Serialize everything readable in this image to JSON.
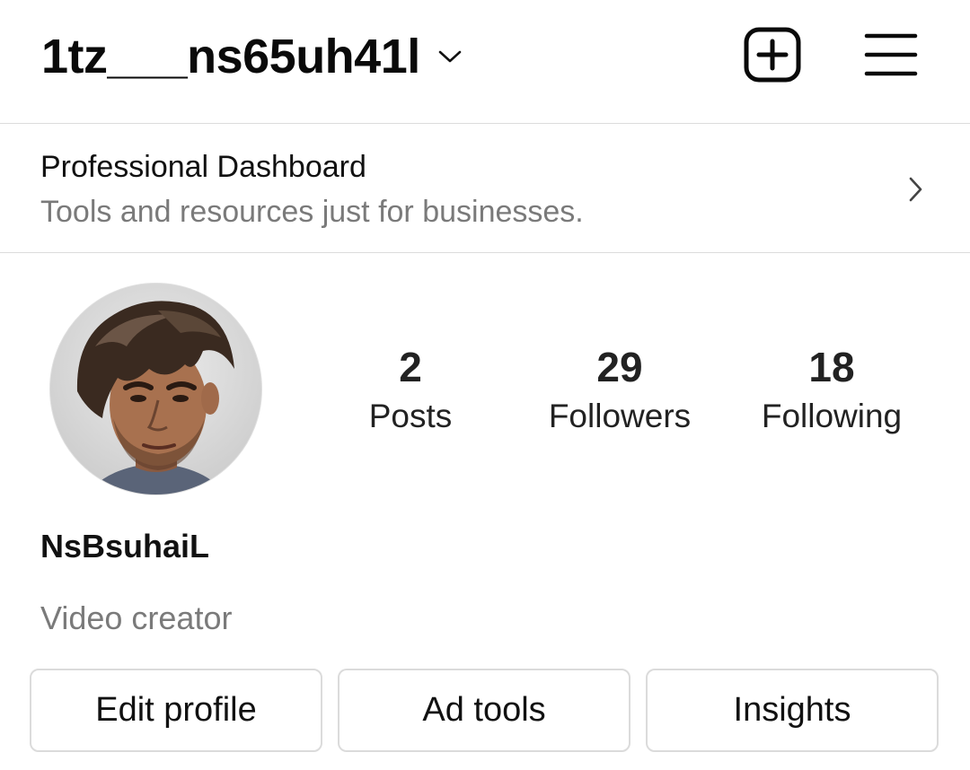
{
  "header": {
    "username": "1tz___ns65uh41l",
    "icons": [
      "chevron-down-icon",
      "add-square-icon",
      "hamburger-menu-icon"
    ]
  },
  "dashboard": {
    "title": "Professional Dashboard",
    "subtitle": "Tools and resources just for businesses.",
    "icon": "chevron-right-icon"
  },
  "profile": {
    "display_name": "NsBsuhaiL",
    "bio": "Video creator",
    "stats": {
      "posts": {
        "value": "2",
        "label": "Posts"
      },
      "followers": {
        "value": "29",
        "label": "Followers"
      },
      "following": {
        "value": "18",
        "label": "Following"
      }
    }
  },
  "buttons": {
    "edit_profile": "Edit profile",
    "ad_tools": "Ad tools",
    "insights": "Insights"
  },
  "colors": {
    "text_primary": "#111111",
    "text_secondary": "#7a7a7a",
    "divider": "#dcdcdc",
    "button_border": "#dbdbdb"
  }
}
